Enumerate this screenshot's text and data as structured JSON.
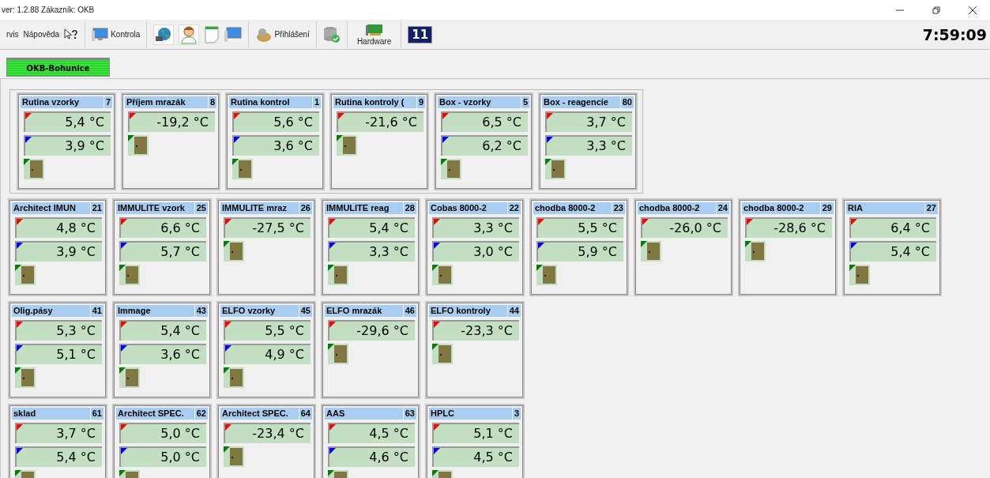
{
  "window": {
    "title": "ver: 1.2.88  Zákazník: OKB"
  },
  "toolbar": {
    "menus": [
      "rvis",
      "Nápověda"
    ],
    "kontrola": "Kontrola",
    "login": "Přihlášení",
    "hardware": "Hardware",
    "badge": "11",
    "clock": "7:59:09"
  },
  "group_tab": {
    "label": "OKB-Bohunice",
    "selected": true
  },
  "rows": [
    [
      {
        "name": "Rutina vzorky",
        "number": "7",
        "readings": [
          {
            "kind": "max",
            "value": "5,4 °C"
          },
          {
            "kind": "min",
            "value": "3,9 °C"
          }
        ]
      },
      {
        "name": "Příjem mrazák",
        "number": "8",
        "readings": [
          {
            "kind": "max",
            "value": "-19,2 °C"
          }
        ]
      },
      {
        "name": "Rutina kontrol",
        "number": "1",
        "readings": [
          {
            "kind": "max",
            "value": "5,6 °C"
          },
          {
            "kind": "min",
            "value": "3,6 °C"
          }
        ]
      },
      {
        "name": "Rutina kontroly (",
        "number": "9",
        "readings": [
          {
            "kind": "max",
            "value": "-21,6 °C"
          }
        ]
      },
      {
        "name": "Box - vzorky",
        "number": "5",
        "readings": [
          {
            "kind": "max",
            "value": "6,5 °C"
          },
          {
            "kind": "min",
            "value": "6,2 °C"
          }
        ]
      },
      {
        "name": "Box - reagencie",
        "number": "80",
        "readings": [
          {
            "kind": "max",
            "value": "3,7 °C"
          },
          {
            "kind": "min",
            "value": "3,3 °C"
          }
        ]
      }
    ],
    [
      {
        "name": "Architect IMUN",
        "number": "21",
        "readings": [
          {
            "kind": "max",
            "value": "4,8 °C"
          },
          {
            "kind": "min",
            "value": "3,9 °C"
          }
        ]
      },
      {
        "name": "IMMULITE vzork",
        "number": "25",
        "readings": [
          {
            "kind": "max",
            "value": "6,6 °C"
          },
          {
            "kind": "min",
            "value": "5,7 °C"
          }
        ]
      },
      {
        "name": "IMMULITE mraz",
        "number": "26",
        "readings": [
          {
            "kind": "max",
            "value": "-27,5 °C"
          }
        ]
      },
      {
        "name": "IMMULITE reag",
        "number": "28",
        "readings": [
          {
            "kind": "max",
            "value": "5,4 °C"
          },
          {
            "kind": "min",
            "value": "3,3 °C"
          }
        ]
      },
      {
        "name": "Cobas 8000-2",
        "number": "22",
        "readings": [
          {
            "kind": "max",
            "value": "3,3 °C"
          },
          {
            "kind": "min",
            "value": "3,0 °C"
          }
        ]
      },
      {
        "name": "chodba 8000-2",
        "number": "23",
        "readings": [
          {
            "kind": "max",
            "value": "5,5 °C"
          },
          {
            "kind": "min",
            "value": "5,9 °C"
          }
        ]
      },
      {
        "name": "chodba 8000-2",
        "number": "24",
        "readings": [
          {
            "kind": "max",
            "value": "-26,0 °C"
          }
        ]
      },
      {
        "name": "chodba 8000-2",
        "number": "29",
        "readings": [
          {
            "kind": "max",
            "value": "-28,6 °C"
          }
        ]
      },
      {
        "name": "RIA",
        "number": "27",
        "readings": [
          {
            "kind": "max",
            "value": "6,4 °C"
          },
          {
            "kind": "min",
            "value": "5,4 °C"
          }
        ]
      }
    ],
    [
      {
        "name": "Olig.pásy",
        "number": "41",
        "readings": [
          {
            "kind": "max",
            "value": "5,3 °C"
          },
          {
            "kind": "min",
            "value": "5,1 °C"
          }
        ]
      },
      {
        "name": "Immage",
        "number": "43",
        "readings": [
          {
            "kind": "max",
            "value": "5,4 °C"
          },
          {
            "kind": "min",
            "value": "3,6 °C"
          }
        ]
      },
      {
        "name": "ELFO vzorky",
        "number": "45",
        "readings": [
          {
            "kind": "max",
            "value": "5,5 °C"
          },
          {
            "kind": "min",
            "value": "4,9 °C"
          }
        ]
      },
      {
        "name": "ELFO mrazák",
        "number": "46",
        "readings": [
          {
            "kind": "max",
            "value": "-29,6 °C"
          }
        ]
      },
      {
        "name": "ELFO kontroly",
        "number": "44",
        "readings": [
          {
            "kind": "max",
            "value": "-23,3 °C"
          }
        ]
      }
    ],
    [
      {
        "name": "sklad",
        "number": "61",
        "readings": [
          {
            "kind": "max",
            "value": "3,7 °C"
          },
          {
            "kind": "min",
            "value": "5,4 °C"
          }
        ]
      },
      {
        "name": "Architect SPEC.",
        "number": "62",
        "readings": [
          {
            "kind": "max",
            "value": "5,0 °C"
          },
          {
            "kind": "min",
            "value": "5,0 °C"
          }
        ]
      },
      {
        "name": "Architect SPEC.",
        "number": "64",
        "readings": [
          {
            "kind": "max",
            "value": "-23,4 °C"
          }
        ]
      },
      {
        "name": "AAS",
        "number": "63",
        "readings": [
          {
            "kind": "max",
            "value": "4,5 °C"
          },
          {
            "kind": "min",
            "value": "4,6 °C"
          }
        ]
      },
      {
        "name": "HPLC",
        "number": "3",
        "readings": [
          {
            "kind": "max",
            "value": "5,1 °C"
          },
          {
            "kind": "min",
            "value": "4,5 °C"
          }
        ]
      }
    ]
  ]
}
